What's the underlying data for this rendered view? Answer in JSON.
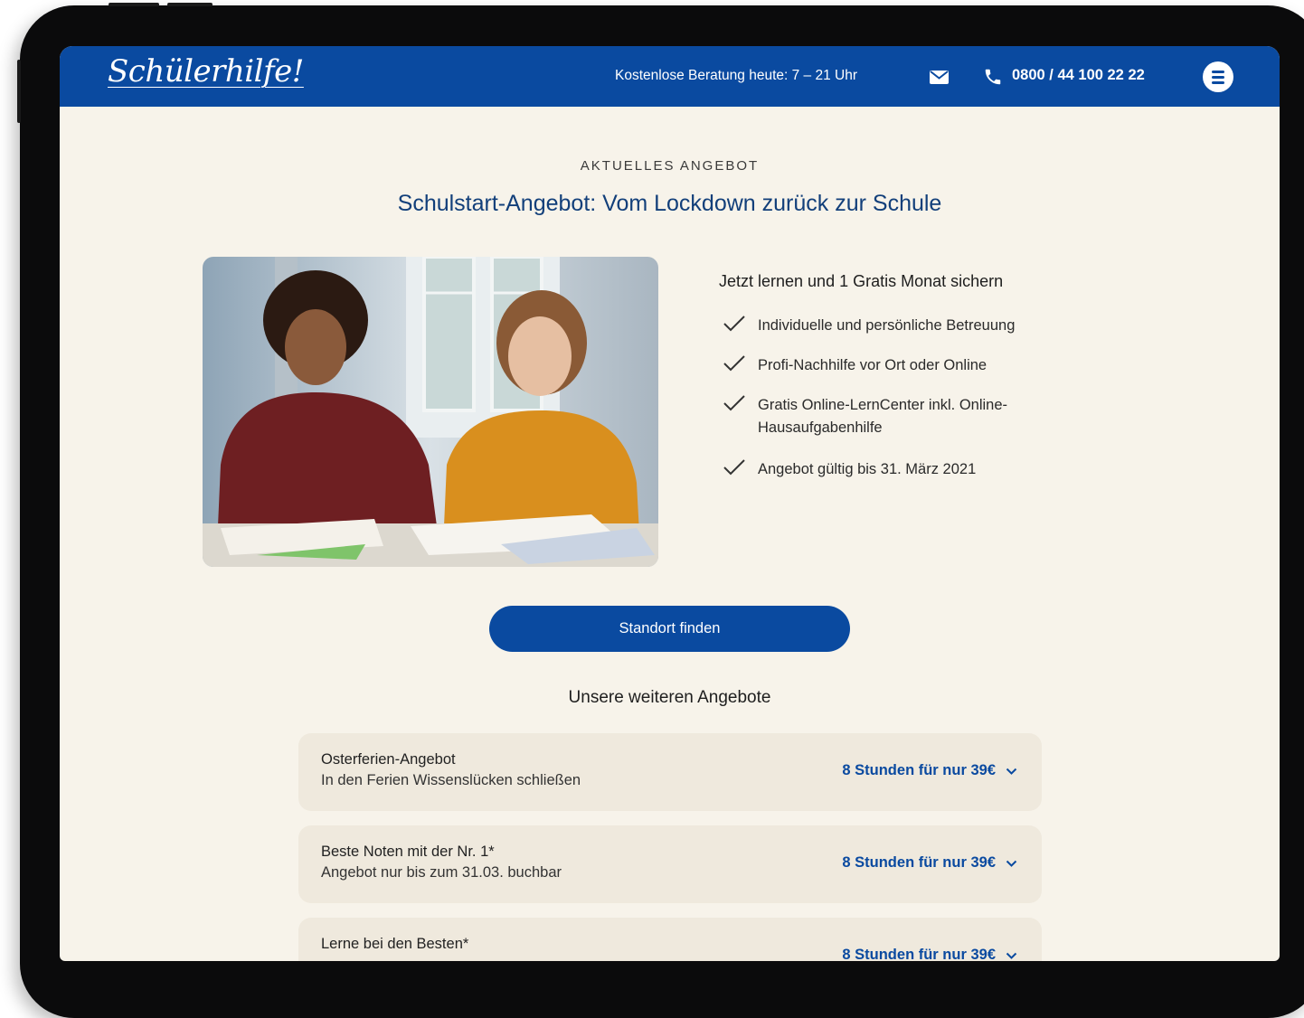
{
  "header": {
    "logo": "Schülerhilfe!",
    "consult_text": "Kostenlose Beratung heute: 7 – 21 Uhr",
    "phone": "0800 / 44 100 22 22",
    "mail_icon": "envelope-icon",
    "phone_icon": "phone-icon",
    "menu_icon": "hamburger-menu-icon"
  },
  "hero": {
    "eyebrow": "AKTUELLES ANGEBOT",
    "title": "Schulstart-Angebot: Vom Lockdown zurück zur Schule",
    "benefits_title": "Jetzt lernen und 1 Gratis Monat sichern",
    "benefits": [
      "Individuelle und persönliche Betreuung",
      "Profi-Nachhilfe vor Ort oder Online",
      "Gratis Online-LernCenter inkl. Online-Hausaufgabenhilfe",
      "Angebot gültig bis 31. März 2021"
    ],
    "cta_label": "Standort finden"
  },
  "offers": {
    "title": "Unsere weiteren Angebote",
    "items": [
      {
        "name": "Osterferien-Angebot",
        "subtitle": "In den Ferien Wissenslücken schließen",
        "price": "8 Stunden für nur 39€"
      },
      {
        "name": "Beste Noten mit der Nr. 1*",
        "subtitle": "Angebot nur bis zum 31.03. buchbar",
        "price": "8 Stunden für nur 39€"
      },
      {
        "name": "Lerne bei den Besten*",
        "subtitle": "",
        "price": "8 Stunden für nur 39€"
      }
    ]
  },
  "colors": {
    "brand_blue": "#0a4aa0",
    "page_bg": "#f7f3ea",
    "card_bg": "#efe9dd",
    "title_blue": "#123f7a"
  }
}
